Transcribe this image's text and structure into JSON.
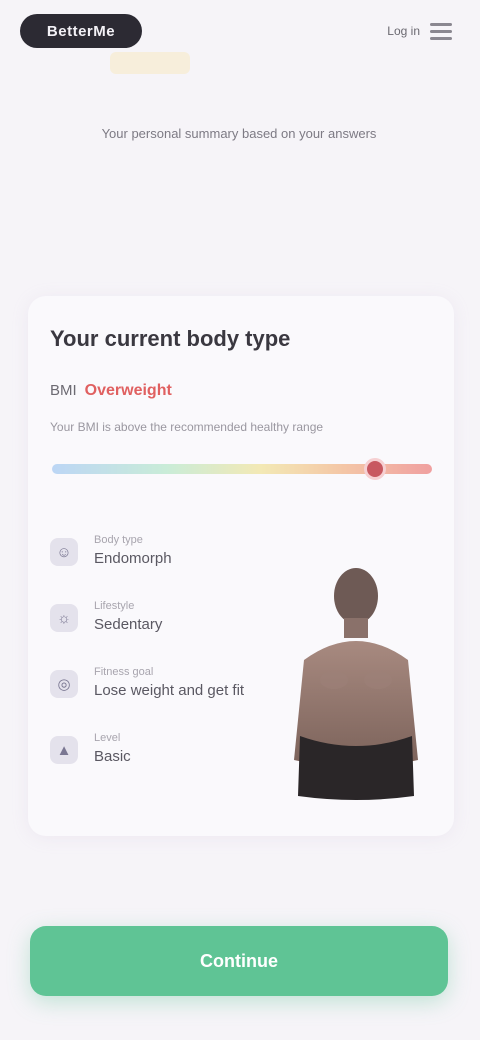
{
  "header": {
    "logo_text": "BetterMe",
    "login_label": "Log in"
  },
  "intro": {
    "subtitle": "Your personal summary based on your answers"
  },
  "summary": {
    "title": "Your current body type",
    "bmi_label": "BMI",
    "bmi_value": "Overweight",
    "bmi_desc": "Your BMI is above the recommended healthy range",
    "bmi_position": 0.85,
    "facts": [
      {
        "icon": "body-type-icon",
        "glyph": "☺",
        "label": "Body type",
        "value": "Endomorph"
      },
      {
        "icon": "lifestyle-icon",
        "glyph": "☼",
        "label": "Lifestyle",
        "value": "Sedentary"
      },
      {
        "icon": "goal-icon",
        "glyph": "◎",
        "label": "Fitness goal",
        "value": "Lose weight and get fit"
      },
      {
        "icon": "level-icon",
        "glyph": "▲",
        "label": "Level",
        "value": "Basic"
      }
    ]
  },
  "cta": {
    "label": "Continue"
  },
  "colors": {
    "accent": "#5fc495",
    "bmi_marker": "#c85860",
    "logo_bg": "#2c2a33"
  }
}
